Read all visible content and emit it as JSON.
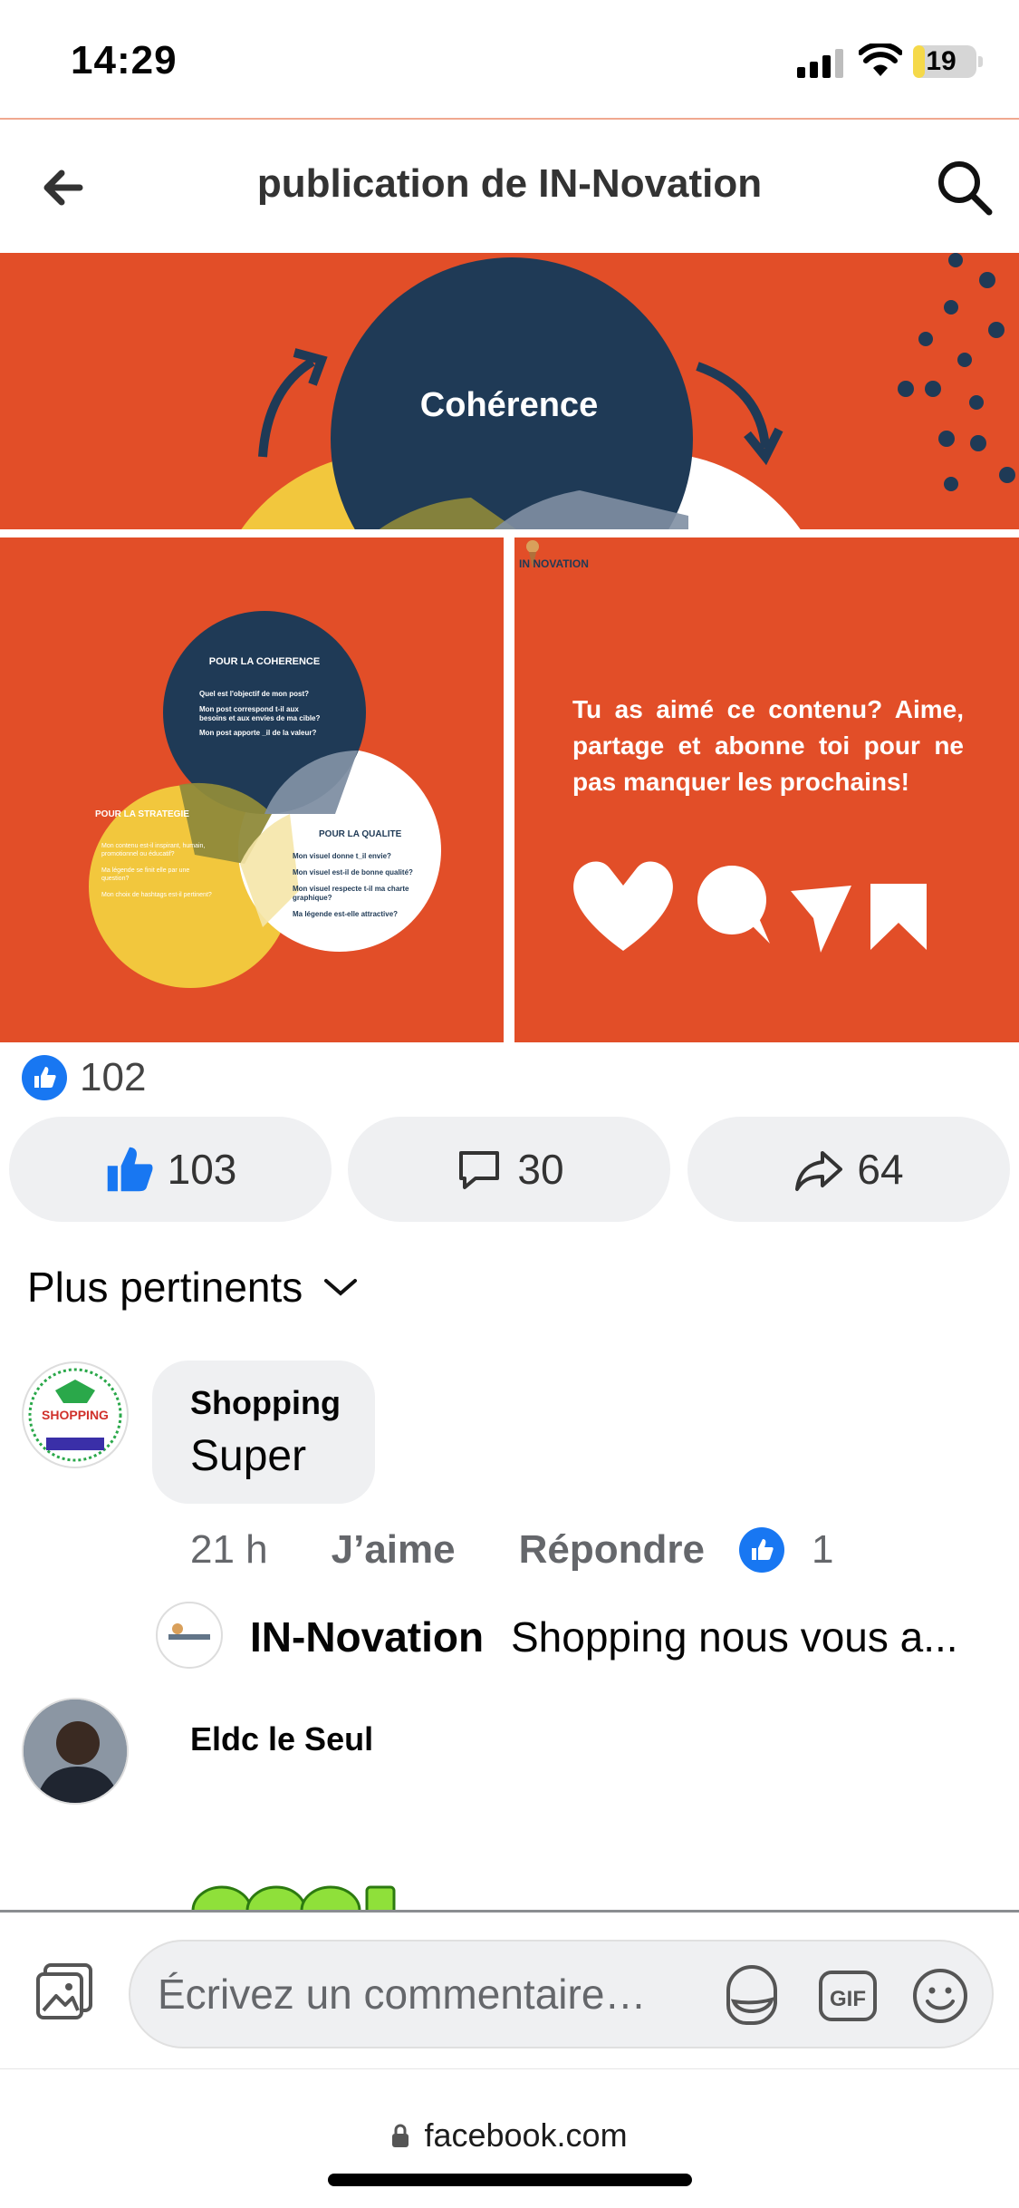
{
  "status_bar": {
    "time": "14:29",
    "battery": "19",
    "battery_level": 0.19
  },
  "header": {
    "title": "publication de IN-Novation"
  },
  "post_images": {
    "top": {
      "heading": "Cohérence"
    },
    "left": {
      "circle_coherence_title": "POUR LA COHERENCE",
      "coherence_items": [
        "Quel est l'objectif de mon post?",
        "Mon post correspond t-il aux",
        "besoins et aux envies de ma cible?",
        "Mon post apporte _il de la valeur?"
      ],
      "circle_strategie_title": "POUR LA STRATEGIE",
      "strategie_items": [
        "Mon contenu est-il inspirant, humain,",
        "promotionnel ou éducatif?",
        "Ma légende se finit elle par une",
        "question?",
        "Mon choix de hashtags est-il pertinent?"
      ],
      "circle_qualite_title": "POUR LA QUALITE",
      "qualite_items": [
        "Mon visuel donne t_il envie?",
        "Mon visuel est-il de bonne qualité?",
        "Mon visuel respecte t-il ma charte",
        "graphique?",
        "Ma légende est-elle attractive?"
      ]
    },
    "right": {
      "brand": "IN NOVATION",
      "cta": "Tu as aimé ce contenu? Aime, partage et abonne toi pour ne pas manquer les prochains!"
    }
  },
  "reactions": {
    "count": "102"
  },
  "actions": {
    "like_count": "103",
    "comment_count": "30",
    "share_count": "64"
  },
  "sort": {
    "label": "Plus pertinents"
  },
  "comments": [
    {
      "author": "Shopping",
      "text": "Super",
      "avatar_label": "SHOPPING",
      "time": "21 h",
      "like_label": "J’aime",
      "reply_label": "Répondre",
      "reaction_count": "1",
      "reply": {
        "author": "IN-Novation",
        "text": "Shopping nous vous a..."
      }
    },
    {
      "author": "Eldc le Seul"
    }
  ],
  "composer": {
    "placeholder": "Écrivez un commentaire…",
    "gif_label": "GIF"
  },
  "browser": {
    "url": "facebook.com"
  },
  "colors": {
    "accent": "#1877f2",
    "post_orange": "#e24e28",
    "navy": "#1f3a56",
    "yellow": "#f2c73d"
  }
}
